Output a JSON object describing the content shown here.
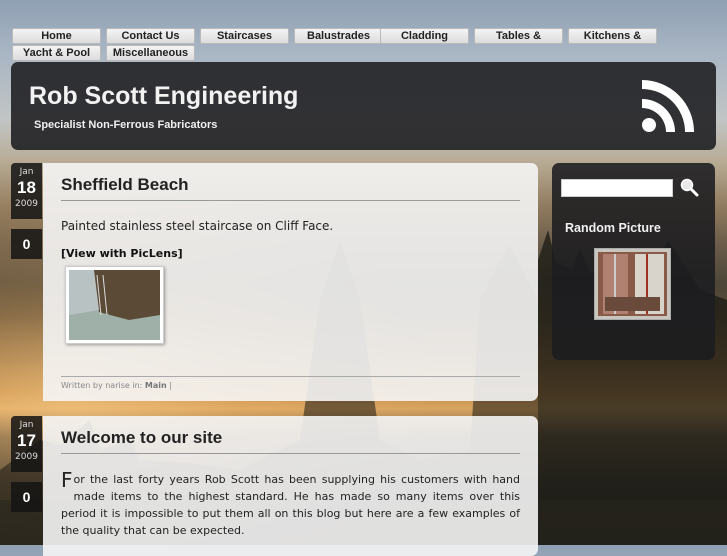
{
  "nav": {
    "items": [
      "Home",
      "Contact Us",
      "Staircases",
      "Balustrades",
      "Cladding",
      "Tables &",
      "Kitchens &",
      "Yacht & Pool",
      "Miscellaneous"
    ]
  },
  "header": {
    "title": "Rob Scott Engineering",
    "tagline": "Specialist Non-Ferrous Fabricators"
  },
  "posts": [
    {
      "month": "Jan",
      "day": "18",
      "year": "2009",
      "comments": "0",
      "title": "Sheffield Beach",
      "text": "Painted stainless steel staircase on Cliff Face.",
      "piclens": "[View with PicLens]",
      "meta_prefix": "Written by narise in:",
      "meta_category": "Main",
      "meta_sep": "|"
    },
    {
      "month": "Jan",
      "day": "17",
      "year": "2009",
      "comments": "0",
      "title": "Welcome to our site",
      "dropcap": "F",
      "body": "or the last forty years Rob Scott has been supplying his customers with hand made items to the highest standard. He has made so many items over this period it is impossible to put them all on this blog but here are a few examples of the quality that can be expected."
    }
  ],
  "sidebar": {
    "search_value": "",
    "random_title": "Random Picture"
  },
  "colors": {
    "panel": "#1c1c20",
    "post_bg": "#f5f5f5",
    "nav_bg": "#e8e8e8"
  }
}
